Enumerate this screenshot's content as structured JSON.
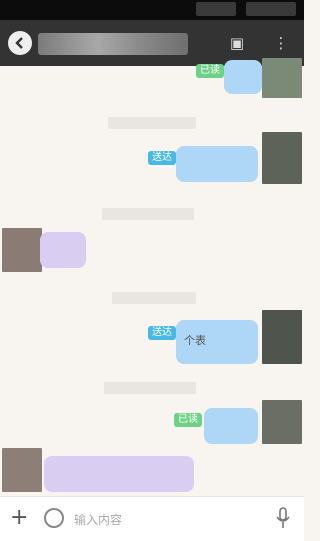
{
  "header": {
    "back_icon": "back-circle-icon",
    "chat_info_icon": "contact-card-icon",
    "menu_icon": "more-vertical-icon"
  },
  "messages": [
    {
      "side": "right",
      "status": "已读"
    },
    {
      "side": "right",
      "status": "送达"
    },
    {
      "side": "left"
    },
    {
      "side": "right",
      "status": "送达",
      "text": "个表"
    },
    {
      "side": "right",
      "status": "已读"
    },
    {
      "side": "left"
    }
  ],
  "input": {
    "placeholder": "输入内容",
    "plus_icon": "plus-icon",
    "emoji_icon": "emoji-icon",
    "voice_icon": "microphone-icon"
  },
  "colors": {
    "sent_badge": "#4ab8e4",
    "read_badge": "#6dd287",
    "outgoing_bubble": "#aed6f6",
    "incoming_bubble": "#d9cdf2"
  }
}
